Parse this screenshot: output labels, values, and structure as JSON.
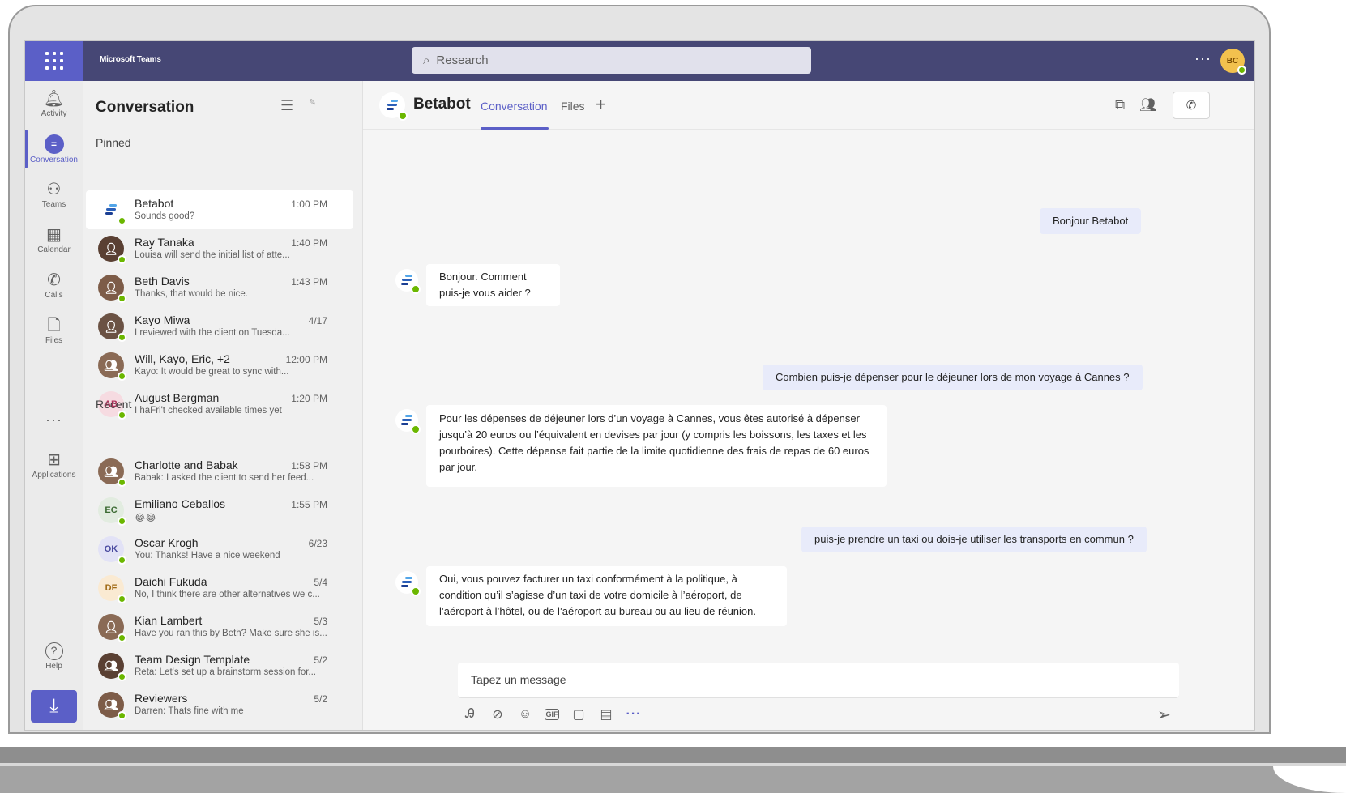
{
  "app": {
    "name": "Microsoft Teams",
    "search_placeholder": "Research",
    "more": "···",
    "user_initials": "BC"
  },
  "rail": {
    "items": [
      {
        "label": "Activity",
        "icon": "bell-icon",
        "glyph": "🔔︎"
      },
      {
        "label": "Conversation",
        "icon": "chat-icon",
        "glyph": "="
      },
      {
        "label": "Teams",
        "icon": "teams-icon",
        "glyph": "⚇"
      },
      {
        "label": "Calendar",
        "icon": "calendar-icon",
        "glyph": "▦"
      },
      {
        "label": "Calls",
        "icon": "phone-icon",
        "glyph": "✆"
      },
      {
        "label": "Files",
        "icon": "file-icon",
        "glyph": "🗋"
      },
      {
        "label": "Applications",
        "icon": "apps-icon",
        "glyph": "⊞"
      },
      {
        "label": "Help",
        "icon": "help-icon",
        "glyph": "?"
      }
    ],
    "more": "···",
    "download_icon": "download-icon"
  },
  "list": {
    "title": "Conversation",
    "pinned_label": "Pinned",
    "recent_label": "Recent",
    "pinned": [
      {
        "name": "Betabot",
        "preview": "Sounds good?",
        "time": "1:00 PM",
        "avatar": "bot",
        "initials": ""
      },
      {
        "name": "Ray Tanaka",
        "preview": "Louisa will send the initial list of atte...",
        "time": "1:40 PM",
        "avatar": "photo",
        "initials": ""
      },
      {
        "name": "Beth Davis",
        "preview": "Thanks, that would be nice.",
        "time": "1:43 PM",
        "avatar": "photo",
        "initials": ""
      },
      {
        "name": "Kayo Miwa",
        "preview": "I reviewed with the client on Tuesda...",
        "time": "4/17",
        "avatar": "photo",
        "initials": ""
      },
      {
        "name": "Will, Kayo, Eric, +2",
        "preview": "Kayo: It would be great to sync with...",
        "time": "12:00 PM",
        "avatar": "group",
        "initials": ""
      },
      {
        "name": "August Bergman",
        "preview": "I haFri't checked available times yet",
        "time": "1:20 PM",
        "avatar": "initials",
        "initials": "AB"
      }
    ],
    "recent": [
      {
        "name": "Charlotte and Babak",
        "preview": "Babak: I asked the client to send her feed...",
        "time": "1:58 PM",
        "avatar": "group",
        "initials": ""
      },
      {
        "name": "Emiliano Ceballos",
        "preview": "😂😂",
        "time": "1:55 PM",
        "avatar": "initials",
        "initials": "EC"
      },
      {
        "name": "Oscar Krogh",
        "preview": "You: Thanks! Have a nice weekend",
        "time": "6/23",
        "avatar": "initials",
        "initials": "OK"
      },
      {
        "name": "Daichi Fukuda",
        "preview": "No, I think there are other alternatives we c...",
        "time": "5/4",
        "avatar": "initials",
        "initials": "DF"
      },
      {
        "name": "Kian Lambert",
        "preview": "Have you ran this by Beth? Make sure she is...",
        "time": "5/3",
        "avatar": "photo",
        "initials": ""
      },
      {
        "name": "Team Design Template",
        "preview": "Reta: Let's set up a brainstorm session for...",
        "time": "5/2",
        "avatar": "group",
        "initials": ""
      },
      {
        "name": "Reviewers",
        "preview": "Darren: Thats fine with me",
        "time": "5/2",
        "avatar": "group",
        "initials": ""
      }
    ]
  },
  "chat": {
    "title": "Betabot",
    "tabs": [
      "Conversation",
      "Files"
    ],
    "add_tab": "+",
    "messages": [
      {
        "from": "me",
        "text": "Bonjour Betabot"
      },
      {
        "from": "bot",
        "text": "Bonjour. Comment puis-je vous aider ?"
      },
      {
        "from": "me",
        "text": "Combien puis-je dépenser pour le déjeuner lors de mon voyage à Cannes ?"
      },
      {
        "from": "bot",
        "text": "Pour les dépenses de déjeuner lors d’un voyage à Cannes, vous êtes autorisé à dépenser jusqu’à 20 euros ou l’équivalent en devises par jour (y compris les boissons, les taxes et les pourboires). Cette dépense fait partie de la limite quotidienne des frais de repas de 60 euros par jour."
      },
      {
        "from": "me",
        "text": "puis-je prendre un taxi ou dois-je utiliser les transports en commun ?"
      },
      {
        "from": "bot",
        "text": "Oui, vous pouvez facturer un taxi conformément à la politique, à condition qu’il s’agisse d’un taxi de votre domicile à l’aéroport, de l’aéroport à l’hôtel, ou de l’aéroport au bureau ou au lieu de réunion."
      }
    ],
    "compose_placeholder": "Tapez un message",
    "tools_more": "···"
  },
  "colors": {
    "brand": "#5b5fc7",
    "topbar": "#464775",
    "presence": "#6bb700",
    "my_bubble": "#e8ebfa"
  }
}
